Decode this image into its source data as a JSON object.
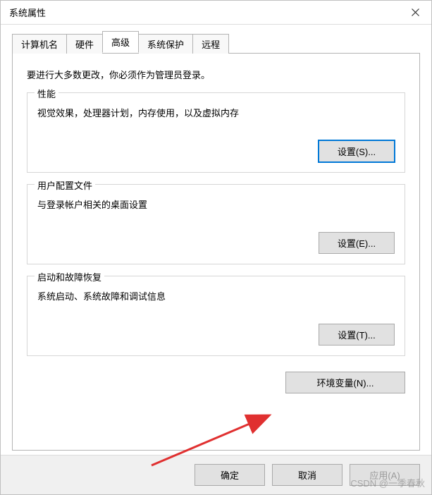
{
  "titlebar": {
    "title": "系统属性"
  },
  "tabs": [
    {
      "label": "计算机名",
      "active": false
    },
    {
      "label": "硬件",
      "active": false
    },
    {
      "label": "高级",
      "active": true
    },
    {
      "label": "系统保护",
      "active": false
    },
    {
      "label": "远程",
      "active": false
    }
  ],
  "intro": "要进行大多数更改，你必须作为管理员登录。",
  "groups": {
    "performance": {
      "legend": "性能",
      "desc": "视觉效果，处理器计划，内存使用，以及虚拟内存",
      "button": "设置(S)..."
    },
    "profiles": {
      "legend": "用户配置文件",
      "desc": "与登录帐户相关的桌面设置",
      "button": "设置(E)..."
    },
    "recovery": {
      "legend": "启动和故障恢复",
      "desc": "系统启动、系统故障和调试信息",
      "button": "设置(T)..."
    }
  },
  "env_button": "环境变量(N)...",
  "footer": {
    "ok": "确定",
    "cancel": "取消",
    "apply": "应用(A)"
  },
  "watermark": "CSDN @一季春秋"
}
